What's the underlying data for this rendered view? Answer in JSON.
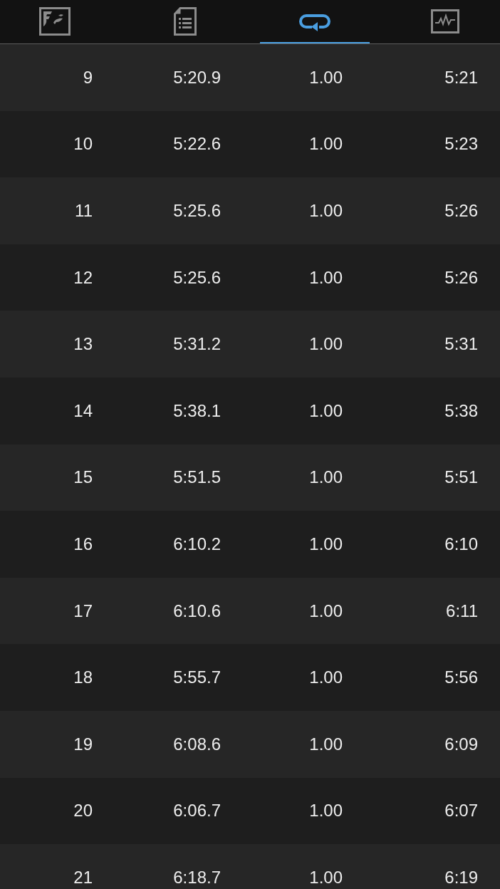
{
  "tabs": [
    {
      "selected": false
    },
    {
      "selected": false
    },
    {
      "selected": true
    },
    {
      "selected": false
    }
  ],
  "table": {
    "rows": [
      [
        "9",
        "5:20.9",
        "1.00",
        "5:21"
      ],
      [
        "10",
        "5:22.6",
        "1.00",
        "5:23"
      ],
      [
        "11",
        "5:25.6",
        "1.00",
        "5:26"
      ],
      [
        "12",
        "5:25.6",
        "1.00",
        "5:26"
      ],
      [
        "13",
        "5:31.2",
        "1.00",
        "5:31"
      ],
      [
        "14",
        "5:38.1",
        "1.00",
        "5:38"
      ],
      [
        "15",
        "5:51.5",
        "1.00",
        "5:51"
      ],
      [
        "16",
        "6:10.2",
        "1.00",
        "6:10"
      ],
      [
        "17",
        "6:10.6",
        "1.00",
        "6:11"
      ],
      [
        "18",
        "5:55.7",
        "1.00",
        "5:56"
      ],
      [
        "19",
        "6:08.6",
        "1.00",
        "6:09"
      ],
      [
        "20",
        "6:06.7",
        "1.00",
        "6:07"
      ],
      [
        "21",
        "6:18.7",
        "1.00",
        "6:19"
      ]
    ]
  }
}
